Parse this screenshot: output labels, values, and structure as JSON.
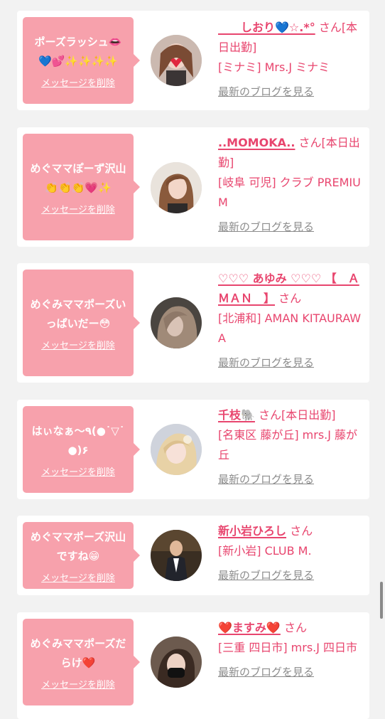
{
  "messages": [
    {
      "bubble": "ポーズラッシュ👄💙💕✨✨✨✨",
      "delete_label": "メッセージを削除",
      "name": "　　しおり💙☆.*°",
      "name_suffix": "さん[本日出勤]",
      "shop": "[ミナミ] Mrs.J ミナミ",
      "blog_label": "最新のブログを見る"
    },
    {
      "bubble": "めぐママぽーず沢山👏👏👏💗✨",
      "delete_label": "メッセージを削除",
      "name": "..MOMOKA..",
      "name_suffix": "さん[本日出勤]",
      "shop": "[岐阜 可児] クラブ PREMIUM",
      "blog_label": "最新のブログを見る"
    },
    {
      "bubble": "めぐみママポーズいっぱいだー😳",
      "delete_label": "メッセージを削除",
      "name": "♡♡♡ あゆみ ♡♡♡ 【　ＡＭＡＮ　】",
      "name_suffix": "さん",
      "shop": "[北浦和] AMAN KITAURAWA",
      "blog_label": "最新のブログを見る"
    },
    {
      "bubble": "はぃなぁ〜٩(●˙▽˙●)۶",
      "delete_label": "メッセージを削除",
      "name": "千枝🐘",
      "name_suffix": "さん[本日出勤]",
      "shop": "[名東区 藤が丘] mrs.J 藤が丘",
      "blog_label": "最新のブログを見る"
    },
    {
      "bubble": "めぐママポーズ沢山ですね😁",
      "delete_label": "メッセージを削除",
      "name": "新小岩ひろし",
      "name_suffix": "さん",
      "shop": "[新小岩] CLUB M.",
      "blog_label": "最新のブログを見る"
    },
    {
      "bubble": "めぐみママポーズだらけ❤️",
      "delete_label": "メッセージを削除",
      "name": "❤️ますみ❤️",
      "name_suffix": "さん",
      "shop": "[三重 四日市] mrs.J 四日市",
      "blog_label": "最新のブログを見る"
    }
  ],
  "colors": {
    "bubble": "#f7a1ac",
    "accent_pink": "#e8456e",
    "muted_link": "#8c8c8c",
    "background": "#f2f2f2"
  }
}
